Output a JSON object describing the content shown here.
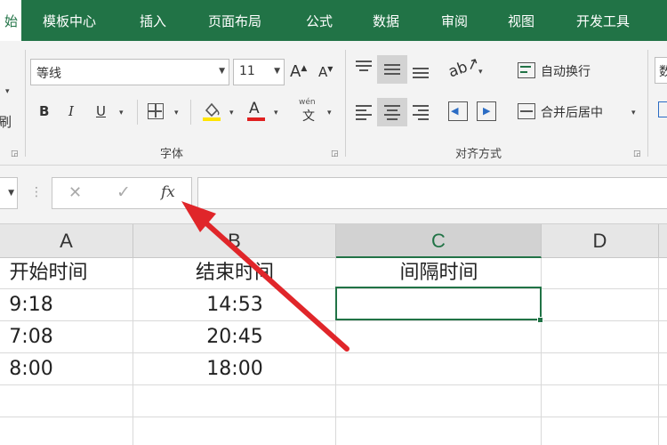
{
  "tabs": [
    {
      "label": "始",
      "active": true
    },
    {
      "label": "模板中心"
    },
    {
      "label": "插入"
    },
    {
      "label": "页面布局"
    },
    {
      "label": "公式"
    },
    {
      "label": "数据"
    },
    {
      "label": "审阅"
    },
    {
      "label": "视图"
    },
    {
      "label": "开发工具"
    }
  ],
  "ribbon": {
    "clipboard_partial": "刷",
    "font_name": "等线",
    "font_size": "11",
    "grow_font": "A",
    "shrink_font": "A",
    "bold": "B",
    "italic": "I",
    "underline": "U",
    "font_color_glyph": "A",
    "phonetic_top": "wén",
    "phonetic_char": "文",
    "font_group_label": "字体",
    "wrap_text_label": "自动换行",
    "merge_center_label": "合并后居中",
    "alignment_group_label": "对齐方式",
    "partial_right": "数"
  },
  "formula_bar": {
    "cancel": "✕",
    "enter": "✓",
    "fx": "fx",
    "content": ""
  },
  "columns": [
    "A",
    "B",
    "C",
    "D"
  ],
  "selected_column": "C",
  "rows": [
    [
      "开始时间",
      "结束时间",
      "间隔时间",
      ""
    ],
    [
      "9:18",
      "14:53",
      "",
      ""
    ],
    [
      "7:08",
      "20:45",
      "",
      ""
    ],
    [
      "8:00",
      "18:00",
      "",
      ""
    ]
  ],
  "colors": {
    "accent": "#217346",
    "annotation_arrow": "#e0262a"
  }
}
